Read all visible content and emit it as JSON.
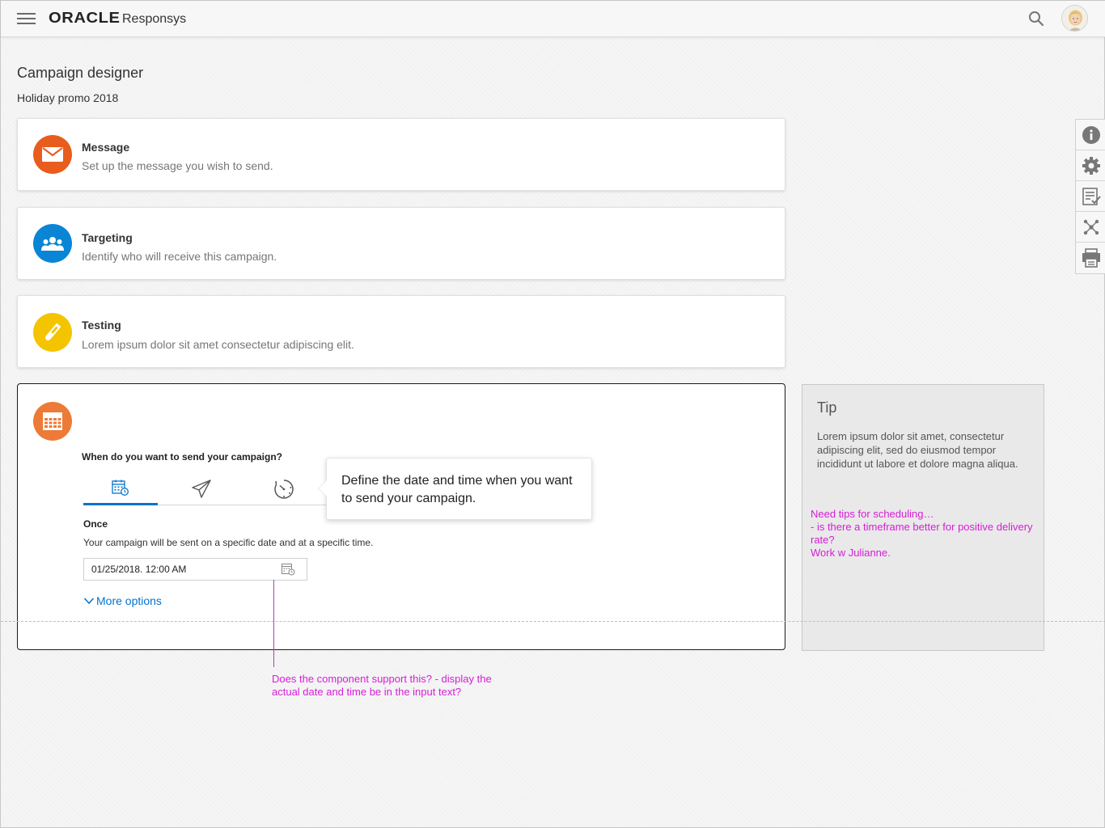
{
  "header": {
    "brand": "ORACLE",
    "product": "Responsys",
    "icons": [
      "menu-icon",
      "search-icon",
      "user-avatar"
    ]
  },
  "page": {
    "title": "Campaign designer",
    "subtitle": "Holiday promo 2018"
  },
  "steps": [
    {
      "title": "Message",
      "description": "Set up the message you wish to send.",
      "icon": "envelope-icon",
      "color": "#e85d1e"
    },
    {
      "title": "Targeting",
      "description": "Identify who will receive this campaign.",
      "icon": "group-icon",
      "color": "#0a85d6"
    },
    {
      "title": "Testing",
      "description": "Lorem ipsum dolor sit amet consectetur adipiscing elit.",
      "icon": "test-tube-icon",
      "color": "#f5c400"
    }
  ],
  "schedule": {
    "icon": "calendar-grid-icon",
    "color": "#ed7a36",
    "question": "When do you want to send your campaign?",
    "tabs": [
      "calendar-clock-icon",
      "paper-plane-icon",
      "timer-icon"
    ],
    "mode": "Once",
    "mode_desc": "Your campaign will be sent on a specific date and at a specific time.",
    "date_value": "01/25/2018. 12:00 AM",
    "more_options": "More options"
  },
  "tooltip": {
    "text": "Define the date and time when you want to send your campaign."
  },
  "tip": {
    "title": "Tip",
    "body": "Lorem ipsum dolor sit amet, consectetur adipiscing elit, sed do eiusmod tempor incididunt ut labore et dolore magna aliqua.",
    "note_line1": "Need tips for scheduling…",
    "note_line2": "- is there a timeframe better for positive delivery rate?",
    "note_line3": "Work w Julianne."
  },
  "annotation": {
    "text": "Does the component support this? - display the actual date and time be in the input text?"
  },
  "side_rail": [
    "info-icon",
    "gear-icon",
    "checklist-icon",
    "network-icon",
    "print-icon"
  ],
  "colors": {
    "accent": "#0572ce",
    "annotation": "#d71dd7"
  }
}
